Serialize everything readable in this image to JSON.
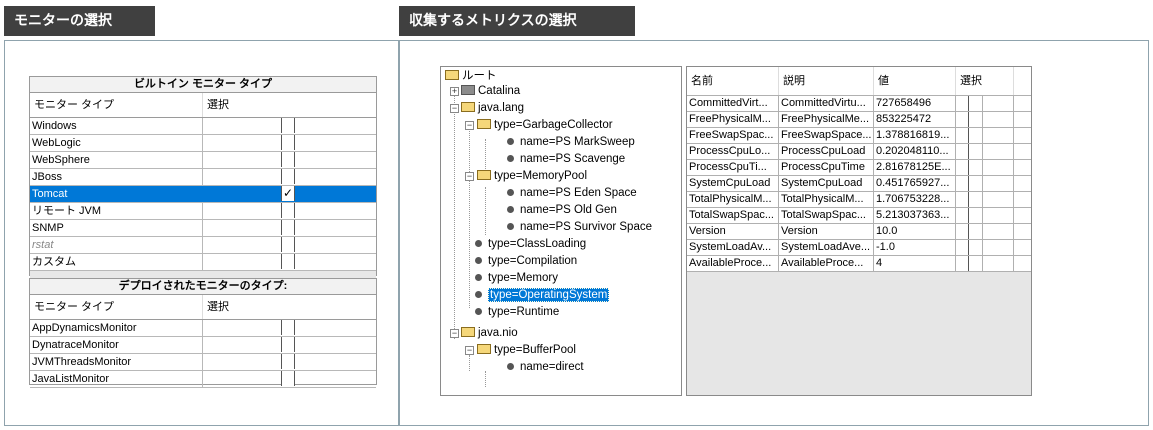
{
  "left_banner": "モニターの選択",
  "right_banner": "収集するメトリクスの選択",
  "builtin": {
    "title": "ビルトイン モニター タイプ",
    "col_type": "モニター タイプ",
    "col_select": "選択",
    "rows": [
      {
        "name": "Windows",
        "checked": false
      },
      {
        "name": "WebLogic",
        "checked": false
      },
      {
        "name": "WebSphere",
        "checked": false
      },
      {
        "name": "JBoss",
        "checked": false
      },
      {
        "name": "Tomcat",
        "checked": true
      },
      {
        "name": "リモート JVM",
        "checked": false
      },
      {
        "name": "SNMP",
        "checked": false
      },
      {
        "name": "rstat",
        "checked": false
      },
      {
        "name": "カスタム",
        "checked": false
      }
    ]
  },
  "deployed": {
    "title": "デプロイされたモニターのタイプ:",
    "col_type": "モニター タイプ",
    "col_select": "選択",
    "rows": [
      {
        "name": "AppDynamicsMonitor"
      },
      {
        "name": "DynatraceMonitor"
      },
      {
        "name": "JVMThreadsMonitor"
      },
      {
        "name": "JavaListMonitor"
      }
    ]
  },
  "tree": {
    "root": "ルート",
    "catalina": "Catalina",
    "java_lang": "java.lang",
    "gc": "type=GarbageCollector",
    "gc_ms": "name=PS MarkSweep",
    "gc_sc": "name=PS Scavenge",
    "mp": "type=MemoryPool",
    "mp_eden": "name=PS Eden Space",
    "mp_old": "name=PS Old Gen",
    "mp_surv": "name=PS Survivor Space",
    "cl": "type=ClassLoading",
    "comp": "type=Compilation",
    "mem": "type=Memory",
    "os": "type=OperatingSystem",
    "rt": "type=Runtime",
    "java_nio": "java.nio",
    "bp": "type=BufferPool",
    "bp_direct": "name=direct"
  },
  "metrics": {
    "col_name": "名前",
    "col_desc": "説明",
    "col_value": "値",
    "col_select": "選択",
    "rows": [
      [
        "CommittedVirt...",
        "CommittedVirtu...",
        "727658496"
      ],
      [
        "FreePhysicalM...",
        "FreePhysicalMe...",
        "853225472"
      ],
      [
        "FreeSwapSpac...",
        "FreeSwapSpace...",
        "1.378816819..."
      ],
      [
        "ProcessCpuLo...",
        "ProcessCpuLoad",
        "0.202048110..."
      ],
      [
        "ProcessCpuTi...",
        "ProcessCpuTime",
        "2.81678125E..."
      ],
      [
        "SystemCpuLoad",
        "SystemCpuLoad",
        "0.451765927..."
      ],
      [
        "TotalPhysicalM...",
        "TotalPhysicalM...",
        "1.706753228..."
      ],
      [
        "TotalSwapSpac...",
        "TotalSwapSpac...",
        "5.213037363..."
      ],
      [
        "Version",
        "Version",
        "10.0"
      ],
      [
        "SystemLoadAv...",
        "SystemLoadAve...",
        "-1.0"
      ],
      [
        "AvailableProce...",
        "AvailableProce...",
        "4"
      ]
    ]
  }
}
